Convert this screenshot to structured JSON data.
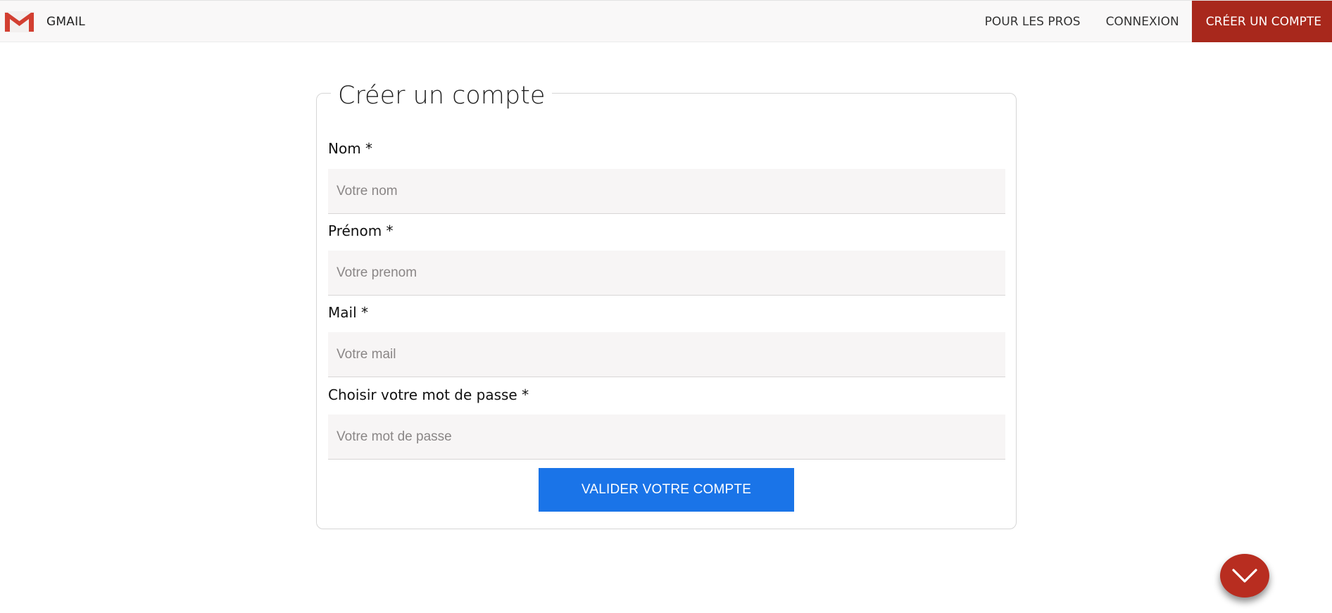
{
  "navbar": {
    "brand_name": "GMAIL",
    "links": [
      {
        "label": "POUR LES PROS"
      },
      {
        "label": "CONNEXION"
      },
      {
        "label": "CRÉER UN COMPTE"
      }
    ]
  },
  "form": {
    "title": "Créer un compte",
    "fields": [
      {
        "label": "Nom *",
        "placeholder": "Votre nom",
        "value": ""
      },
      {
        "label": "Prénom *",
        "placeholder": "Votre prenom",
        "value": ""
      },
      {
        "label": "Mail *",
        "placeholder": "Votre mail",
        "value": ""
      },
      {
        "label": "Choisir votre mot de passe *",
        "placeholder": "Votre mot de passe",
        "value": ""
      }
    ],
    "submit_label": "VALIDER VOTRE COMPTE"
  },
  "fab": {
    "icon": "chevron-down-icon"
  },
  "colors": {
    "brand_red": "#a8281c",
    "fab_red": "#b82d20",
    "primary_blue": "#1a74e8",
    "input_bg": "#f7f5f5"
  }
}
